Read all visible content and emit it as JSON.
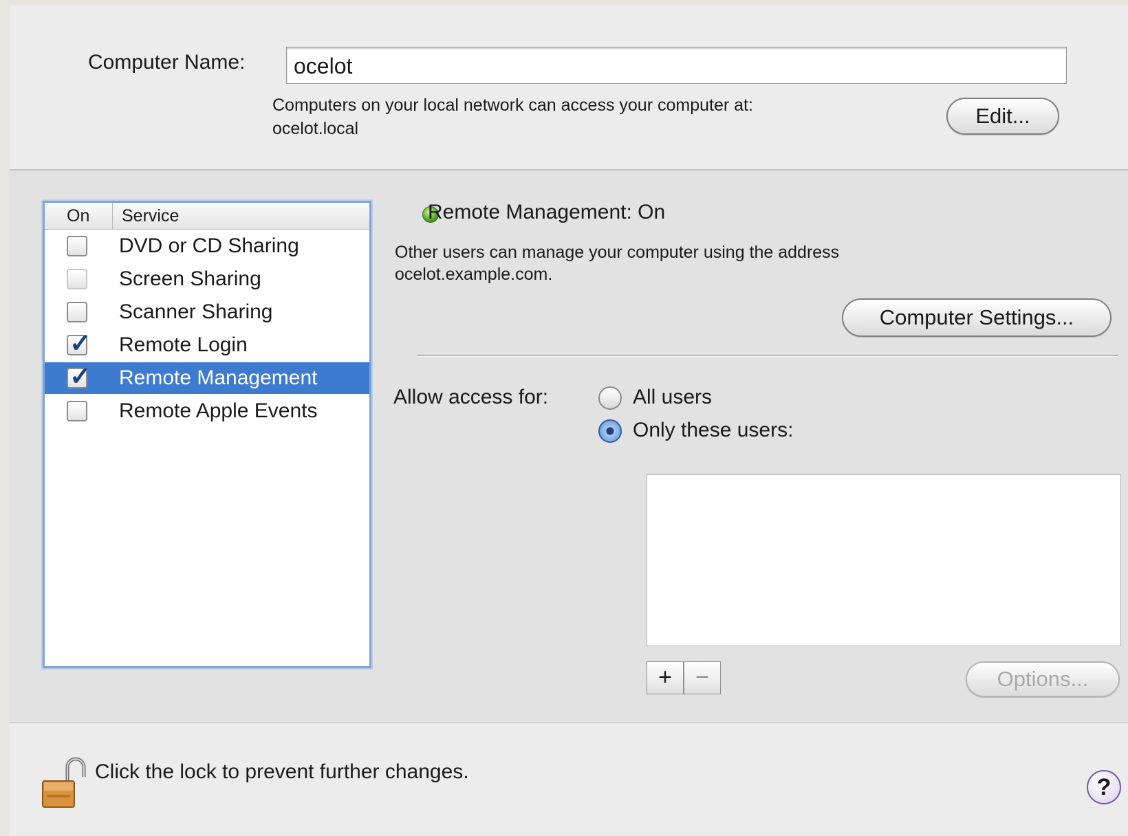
{
  "computer_name": {
    "label": "Computer Name:",
    "value": "ocelot",
    "access_text_line1": "Computers on your local network can access your computer at:",
    "access_text_line2": "ocelot.local",
    "edit_button": "Edit..."
  },
  "services": {
    "header_on": "On",
    "header_service": "Service",
    "items": [
      {
        "label": "DVD or CD Sharing",
        "checked": false
      },
      {
        "label": "Screen Sharing",
        "checked": false
      },
      {
        "label": "Scanner Sharing",
        "checked": false
      },
      {
        "label": "Remote Login",
        "checked": true
      },
      {
        "label": "Remote Management",
        "checked": true,
        "selected": true
      },
      {
        "label": "Remote Apple Events",
        "checked": false
      }
    ]
  },
  "detail": {
    "status_title": "Remote Management: On",
    "status_color": "#4da620",
    "description_line1": "Other users can manage your computer using the address",
    "description_line2": "ocelot.example.com.",
    "computer_settings_button": "Computer Settings...",
    "allow_access_label": "Allow access for:",
    "radio_all_users": "All users",
    "radio_only_these": "Only these users:",
    "selected_access": "Only these users:",
    "add_button": "+",
    "remove_button": "−",
    "options_button": "Options..."
  },
  "footer": {
    "lock_text": "Click the lock to prevent further changes.",
    "help_button": "?"
  }
}
